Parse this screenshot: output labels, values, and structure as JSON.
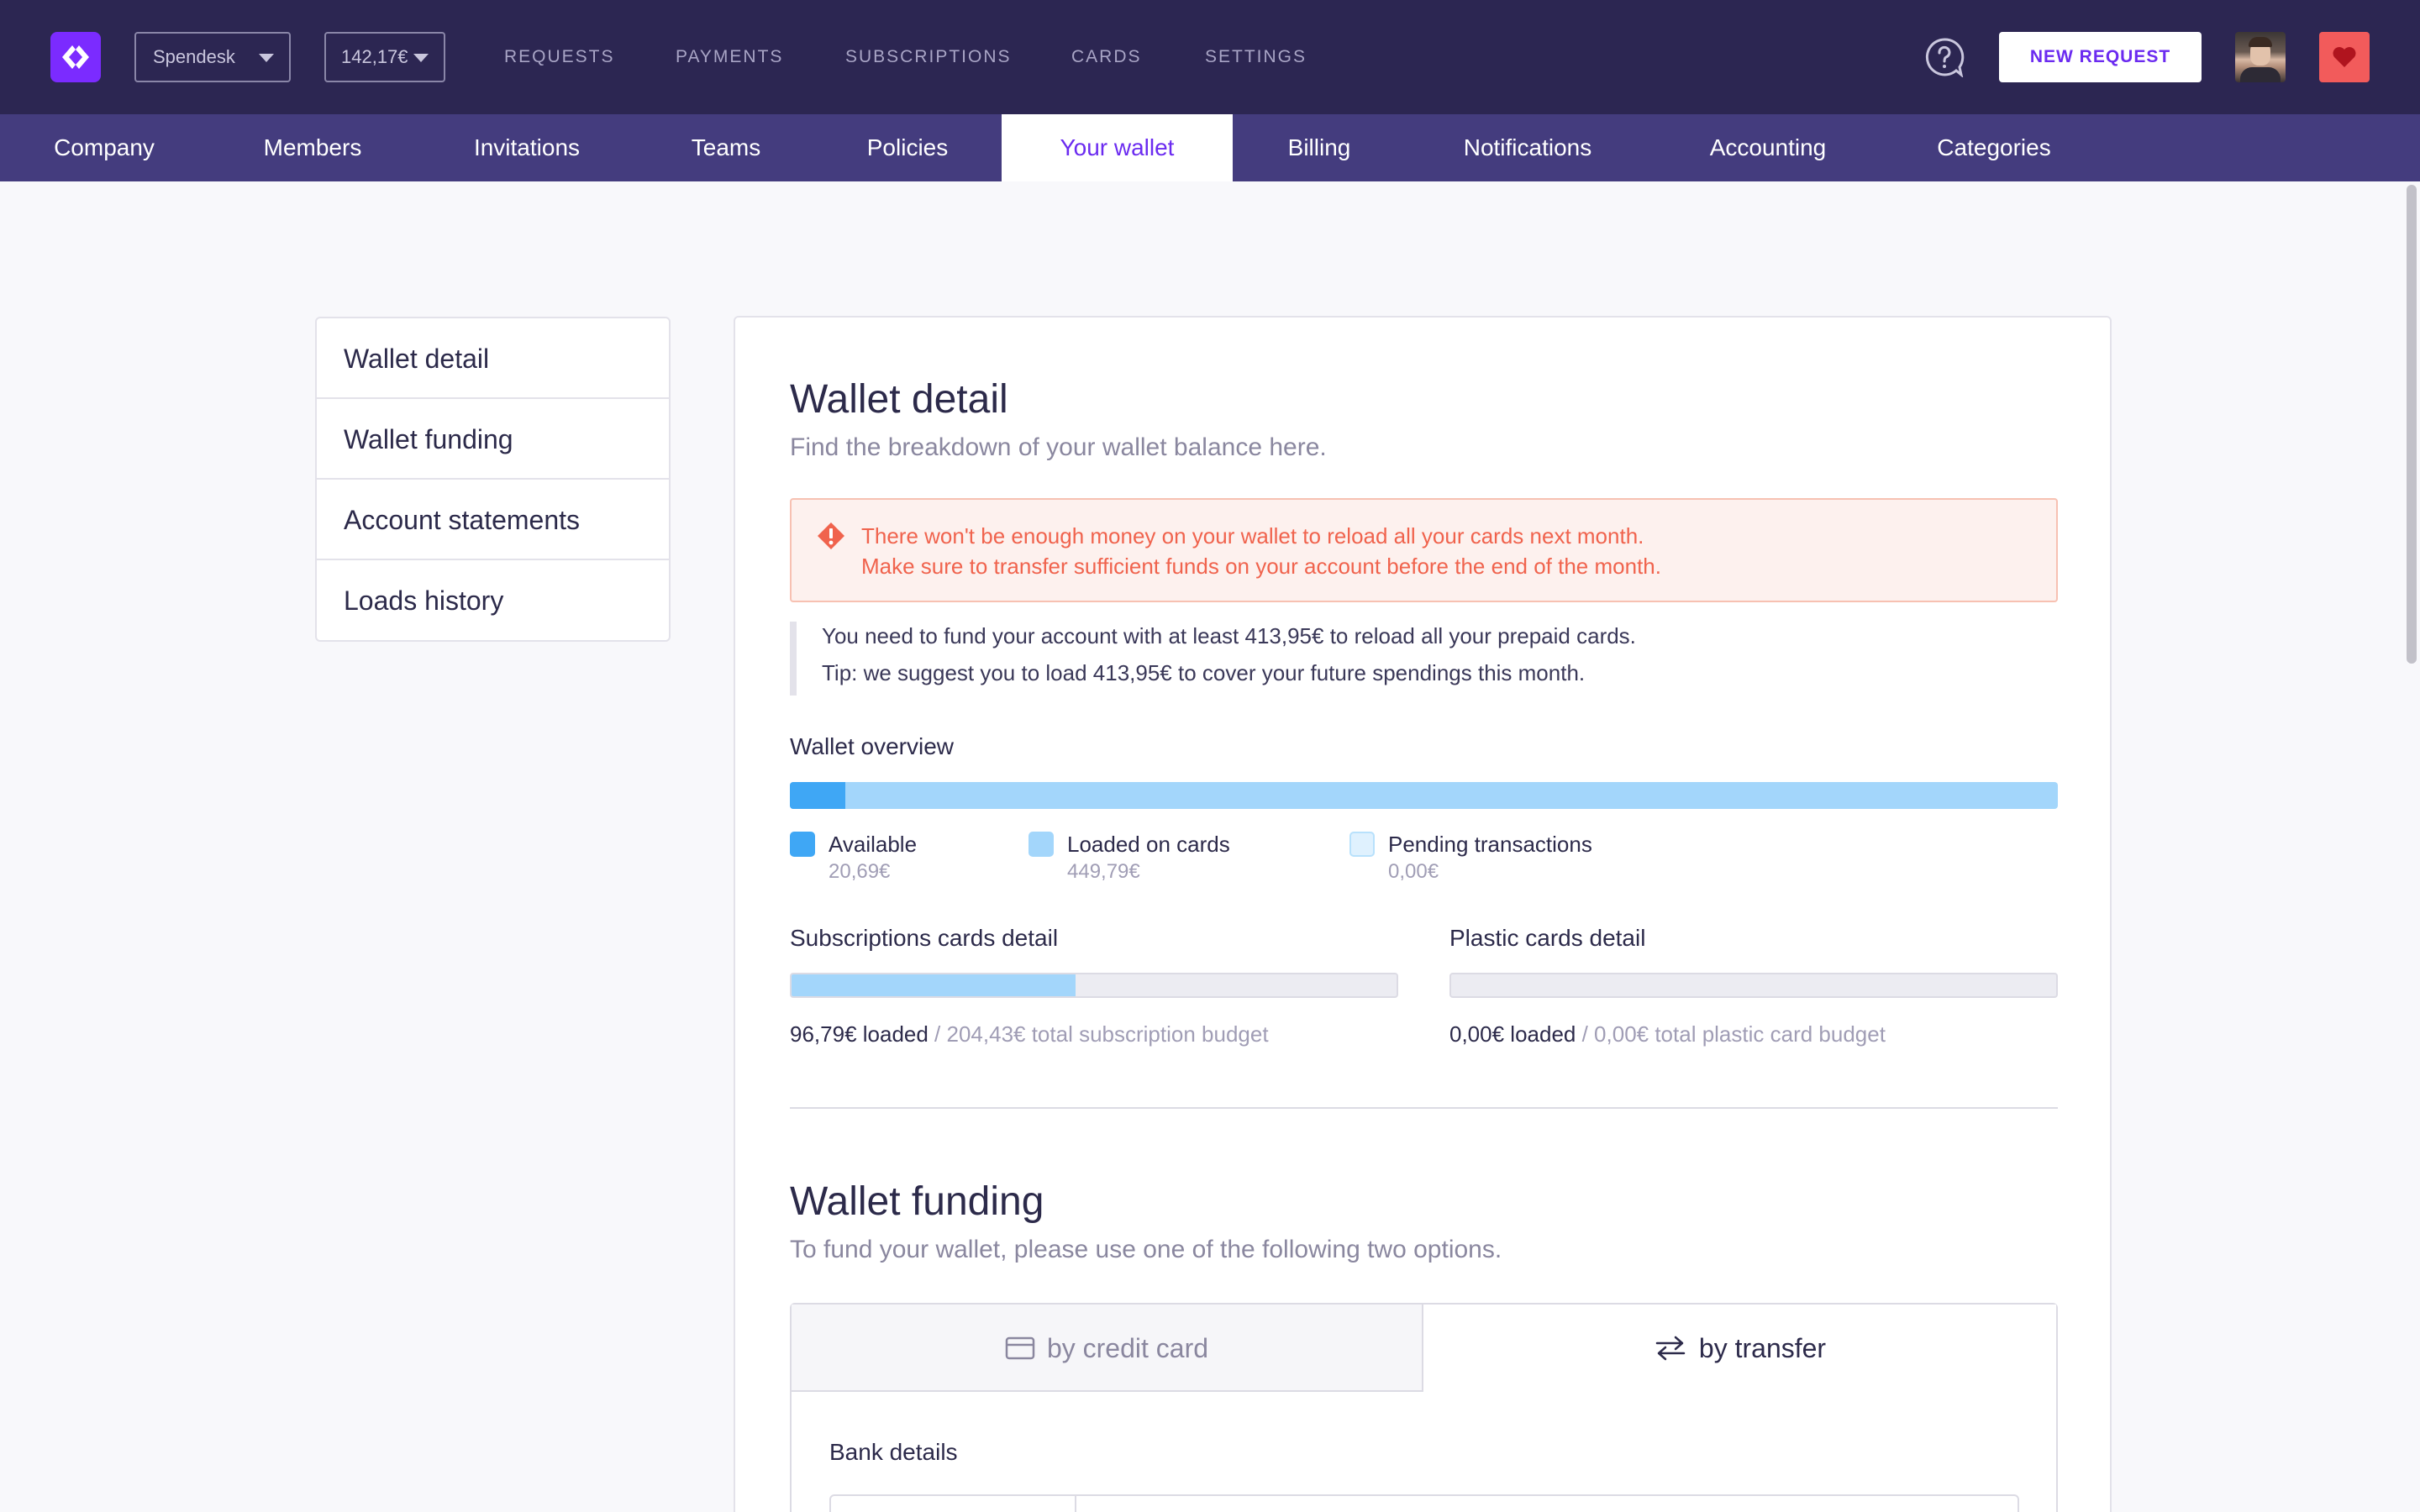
{
  "header": {
    "company": "Spendesk",
    "balance": "142,17€",
    "nav": [
      "REQUESTS",
      "PAYMENTS",
      "SUBSCRIPTIONS",
      "CARDS",
      "SETTINGS"
    ],
    "new_request": "NEW REQUEST",
    "icons": {
      "logo": "spendesk-logo-icon",
      "help": "help-chat-icon",
      "heart": "heart-icon"
    },
    "colors": {
      "topbar": "#2c2652",
      "subnav": "#443c7e",
      "accent": "#6b2bf0",
      "heart": "#f25b5b"
    }
  },
  "subnav": {
    "items": [
      "Company",
      "Members",
      "Invitations",
      "Teams",
      "Policies",
      "Your wallet",
      "Billing",
      "Notifications",
      "Accounting",
      "Categories"
    ],
    "active": "Your wallet"
  },
  "side_menu": {
    "items": [
      "Wallet detail",
      "Wallet funding",
      "Account statements",
      "Loads history"
    ]
  },
  "wallet_detail": {
    "title": "Wallet detail",
    "subtitle": "Find the breakdown of your wallet balance here.",
    "alert": {
      "icon": "warning-icon",
      "line1": "There won't be enough money on your wallet to reload all your cards next month.",
      "line2": "Make sure to transfer sufficient funds on your account before the end of the month."
    },
    "info": {
      "line1": "You need to fund your account with at least 413,95€ to reload all your prepaid cards.",
      "line2": "Tip: we suggest you to load 413,95€ to cover your future spendings this month."
    },
    "overview": {
      "label": "Wallet overview",
      "available_fraction": 0.044,
      "legend": [
        {
          "label": "Available",
          "value": "20,69€",
          "color": "#3fa7f5"
        },
        {
          "label": "Loaded on cards",
          "value": "449,79€",
          "color": "#a3d6fb"
        },
        {
          "label": "Pending transactions",
          "value": "0,00€",
          "color": "#dff1fe"
        }
      ]
    },
    "subscriptions": {
      "label": "Subscriptions cards detail",
      "loaded": "96,79€ loaded",
      "total": " / 204,43€ total subscription budget",
      "fraction": 0.47
    },
    "plastic": {
      "label": "Plastic cards detail",
      "loaded": "0,00€ loaded",
      "total": " / 0,00€ total plastic card budget",
      "fraction": 0
    }
  },
  "wallet_funding": {
    "title": "Wallet funding",
    "subtitle": "To fund your wallet, please use one of the following two options.",
    "tabs": [
      {
        "label": "by credit card",
        "icon": "credit-card-icon"
      },
      {
        "label": "by transfer",
        "icon": "transfer-arrows-icon"
      }
    ],
    "active_tab": "by transfer",
    "bank_details_label": "Bank details"
  }
}
